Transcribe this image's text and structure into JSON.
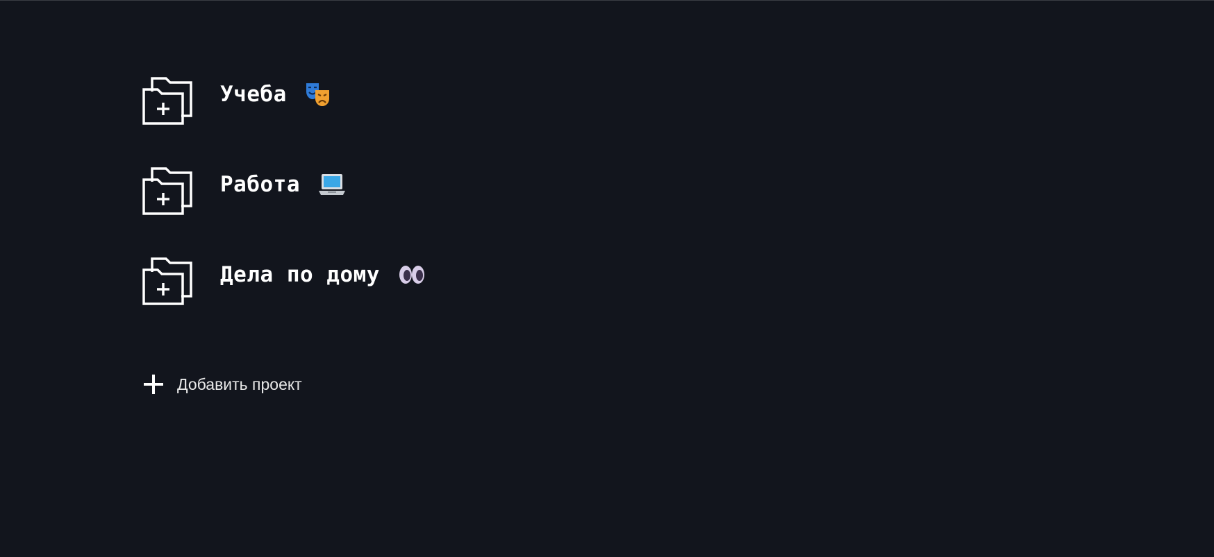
{
  "projects": [
    {
      "label": "Учеба",
      "emoji_icon": "theater-masks-icon"
    },
    {
      "label": "Работа",
      "emoji_icon": "laptop-icon"
    },
    {
      "label": "Дела по дому",
      "emoji_icon": "eyes-icon"
    }
  ],
  "add_project": {
    "label": "Добавить проект",
    "icon": "plus-icon"
  },
  "colors": {
    "background": "#12151d",
    "text": "#ffffff",
    "folder_stroke": "#ffffff"
  }
}
